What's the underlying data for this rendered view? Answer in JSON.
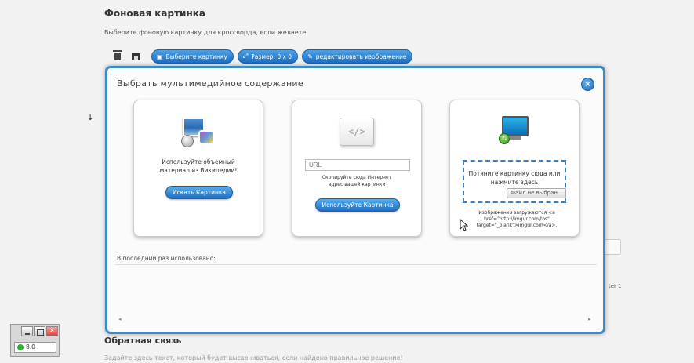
{
  "page": {
    "section_title": "Фоновая картинка",
    "section_desc": "Выберите фоновую картинку для кроссворда, если желаете.",
    "feedback_title": "Обратная связь",
    "feedback_desc": "Задайте здесь текст, который будет высвечиваться, если найдено правильное решение!",
    "side_text": "ter 1"
  },
  "toolbar": {
    "choose_image": "Выберите картинку",
    "size": "Размер: 0 x 0",
    "edit_image": "редактировать изображение"
  },
  "modal": {
    "title": "Выбрать мультимедийное содержание",
    "close": "×",
    "wiki_card": {
      "text": "Используйте объемный материал из Википедии!",
      "button": "Искать Картинка"
    },
    "url_card": {
      "placeholder": "URL",
      "text": "Скопируйте сюда Интернет адрес вашей картинки",
      "button": "Используйте Картинка"
    },
    "upload_card": {
      "drop_text": "Потяните картинку сюда или нажмите здесь",
      "file_button": "Файл не выбран",
      "imgur_text": "Изображения загружаются <a href=\"http://imgur.com/tos\" target=\"_blank\">imgur.com</a>."
    },
    "recent_label": "В последний раз использовано:",
    "scroll_left": "◂",
    "scroll_right": "▸"
  },
  "mini_window": {
    "close": "×",
    "status": "8.0"
  },
  "colors": {
    "accent": "#1f6fc2",
    "modal_border": "#3a8cc6",
    "status_dot": "#2ab32a"
  },
  "icons": [
    "trash-icon",
    "image-icon",
    "resize-icon",
    "edit-icon",
    "down-arrow-icon",
    "wikipedia-media-icon",
    "code-icon",
    "monitor-upload-icon",
    "cursor-icon"
  ]
}
